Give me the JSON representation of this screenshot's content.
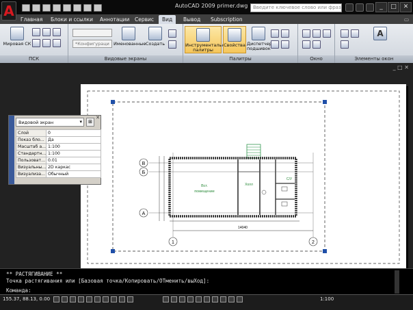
{
  "title_bar": {
    "app_logo": "A",
    "doc_title": "AutoCAD 2009 primer.dwg",
    "search_placeholder": "Введите ключевое слово или фразу"
  },
  "ribbon_tabs": [
    "Главная",
    "Блоки и ссылки",
    "Аннотации",
    "Сервис",
    "Вид",
    "Вывод",
    "Subscription"
  ],
  "active_tab": "Вид",
  "ribbon": {
    "ucs_panel": {
      "title": "ПСК",
      "world_ucs_label": "Мировая СК"
    },
    "viewports_panel": {
      "title": "Видовые экраны",
      "config_combo": "*Конфигураци",
      "named_label": "Именованные",
      "create_label": "Создать"
    },
    "palettes_panel": {
      "title": "Палитры",
      "tool_palettes_label": "Инструментальные палитры",
      "properties_label": "Свойства",
      "subscription_label": "Диспетчер подшивок"
    },
    "window_panel": {
      "title": "Окно"
    },
    "window_elements_panel": {
      "title": "Элементы окон"
    }
  },
  "properties_palette": {
    "combo_value": "Видовой экран",
    "rows": [
      {
        "key": "Слой",
        "value": "0"
      },
      {
        "key": "Показ бло...",
        "value": "Да"
      },
      {
        "key": "Масштаб а...",
        "value": "1:100"
      },
      {
        "key": "Стандартн...",
        "value": "1:100"
      },
      {
        "key": "Пользоват...",
        "value": "0.01"
      },
      {
        "key": "Визуальны...",
        "value": "2D каркас"
      },
      {
        "key": "Визуализа...",
        "value": "Обычный"
      }
    ]
  },
  "drawing": {
    "axis_labels": [
      "В",
      "Б",
      "А",
      "1",
      "2"
    ],
    "room_label_1": "Вст.",
    "room_label_2": "помещение",
    "corridor_label": "Холл",
    "wc_label": "С/У",
    "dimension_total": "14040"
  },
  "command_line": {
    "line1": "** РАСТЯГИВАНИЕ **",
    "line2": "Точка растягивания или [Базовая точка/Копировать/ОТменить/выХод]:",
    "line3": "Команда:"
  },
  "status_bar": {
    "coords": "155.37, 88.13, 0.00",
    "scale": "1:100"
  },
  "colors": {
    "accent_red": "#d71920",
    "ribbon_bg": "#dfe3e8",
    "grip_blue": "#1f4fa8"
  }
}
